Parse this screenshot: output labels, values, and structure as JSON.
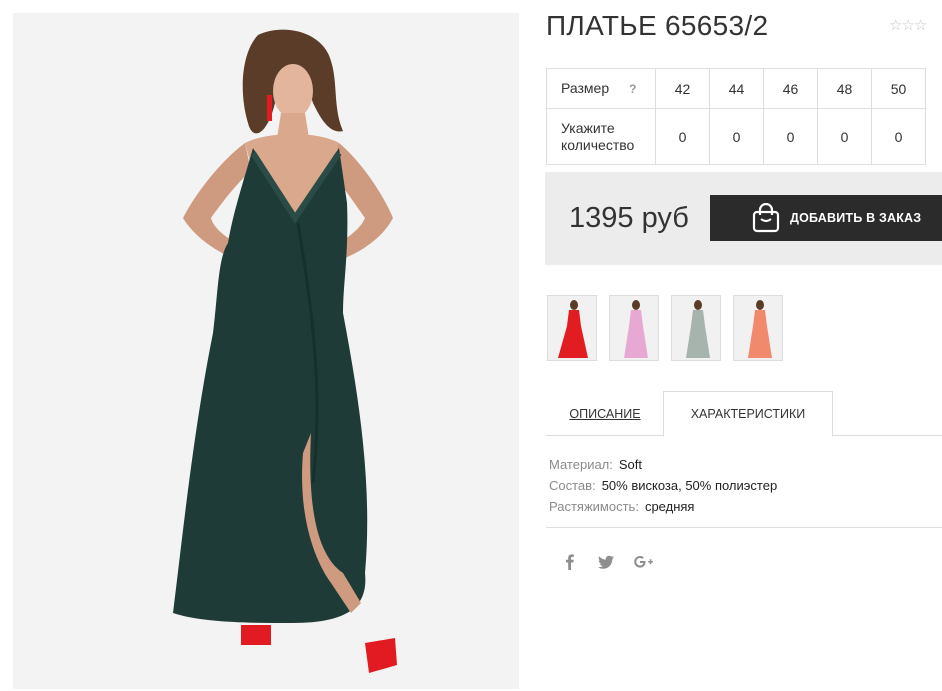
{
  "product": {
    "title": "ПЛАТЬЕ 65653/2",
    "rating_icon": "star-outline-icon",
    "rating_count": 5
  },
  "sizes": {
    "size_label": "Размер",
    "help": "?",
    "qty_label_1": "Укажите",
    "qty_label_2": "количество",
    "items": [
      {
        "size": "42",
        "qty": "0"
      },
      {
        "size": "44",
        "qty": "0"
      },
      {
        "size": "46",
        "qty": "0"
      },
      {
        "size": "48",
        "qty": "0"
      },
      {
        "size": "50",
        "qty": "0"
      }
    ]
  },
  "price": {
    "value": "1395 руб",
    "button": "ДОБАВИТЬ В ЗАКАЗ",
    "button_icon": "shopping-bag-icon"
  },
  "colors": {
    "main_dress": "#1f3b37",
    "button_bg": "#2b2b2b",
    "thumb_dresses": [
      "#e11d22",
      "#e8a8d4",
      "#a7b4ae",
      "#f18a6d"
    ]
  },
  "tabs": {
    "description": "ОПИСАНИЕ",
    "characteristics": "ХАРАКТЕРИСТИКИ",
    "active": "characteristics"
  },
  "specs": [
    {
      "key": "Материал:",
      "value": "Soft"
    },
    {
      "key": "Состав:",
      "value": "50% вискоза, 50% полиэстер"
    },
    {
      "key": "Растяжимость:",
      "value": "средняя"
    }
  ],
  "social": [
    "facebook-icon",
    "twitter-icon",
    "google-plus-icon"
  ]
}
